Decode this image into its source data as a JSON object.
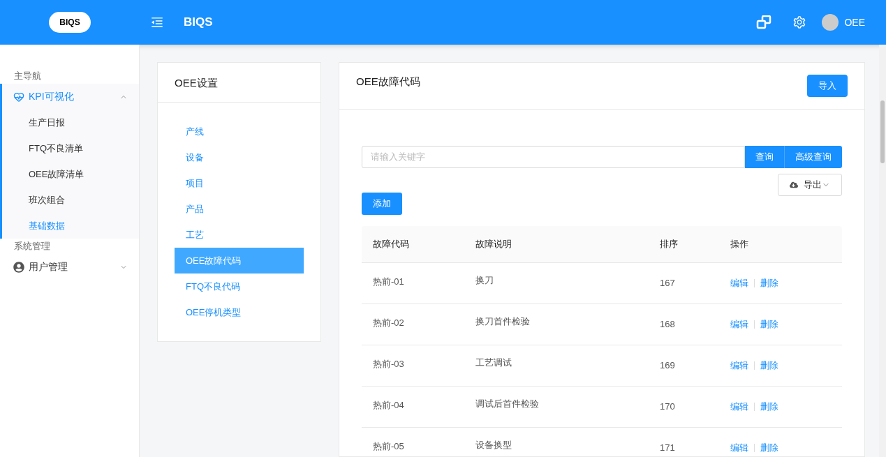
{
  "header": {
    "logo": "BIQS",
    "title": "BIQS",
    "user": "OEE"
  },
  "sidebar": [
    {
      "label": "主导航",
      "groups": [
        {
          "label": "KPI可视化",
          "kind": "heart",
          "expanded": true,
          "children": [
            {
              "label": "生产日报",
              "selected": false
            },
            {
              "label": "FTQ不良清单",
              "selected": false
            },
            {
              "label": "OEE故障清单",
              "selected": false
            },
            {
              "label": "班次组合",
              "selected": false
            },
            {
              "label": "基础数据",
              "selected": true
            }
          ]
        }
      ]
    },
    {
      "label": "系统管理",
      "groups": [
        {
          "label": "用户管理",
          "kind": "user",
          "expanded": false
        }
      ]
    }
  ],
  "settings_card": {
    "title": "OEE设置",
    "items": [
      {
        "label": "产线",
        "selected": false
      },
      {
        "label": "设备",
        "selected": false
      },
      {
        "label": "项目",
        "selected": false
      },
      {
        "label": "产品",
        "selected": false
      },
      {
        "label": "工艺",
        "selected": false
      },
      {
        "label": "OEE故障代码",
        "selected": true
      },
      {
        "label": "FTQ不良代码",
        "selected": false
      },
      {
        "label": "OEE停机类型",
        "selected": false
      }
    ]
  },
  "main_card": {
    "title": "OEE故障代码",
    "import_button": "导入",
    "search": {
      "placeholder": "请输入关键字"
    },
    "query_button": "查询",
    "advanced_button": "高级查询",
    "export_button": "导出",
    "add_button": "添加",
    "table": {
      "columns": [
        "故障代码",
        "故障说明",
        "排序",
        "操作"
      ],
      "rows": [
        {
          "code": "热前-01",
          "description": "换刀",
          "order": "167",
          "actions": [
            "编辑",
            "删除"
          ]
        },
        {
          "code": "热前-02",
          "description": "换刀首件检验",
          "order": "168",
          "actions": [
            "编辑",
            "删除"
          ]
        },
        {
          "code": "热前-03",
          "description": "工艺调试",
          "order": "169",
          "actions": [
            "编辑",
            "删除"
          ]
        },
        {
          "code": "热前-04",
          "description": "调试后首件检验",
          "order": "170",
          "actions": [
            "编辑",
            "删除"
          ]
        },
        {
          "code": "热前-05",
          "description": "设备换型",
          "order": "171",
          "actions": [
            "编辑",
            "删除"
          ]
        }
      ]
    }
  }
}
